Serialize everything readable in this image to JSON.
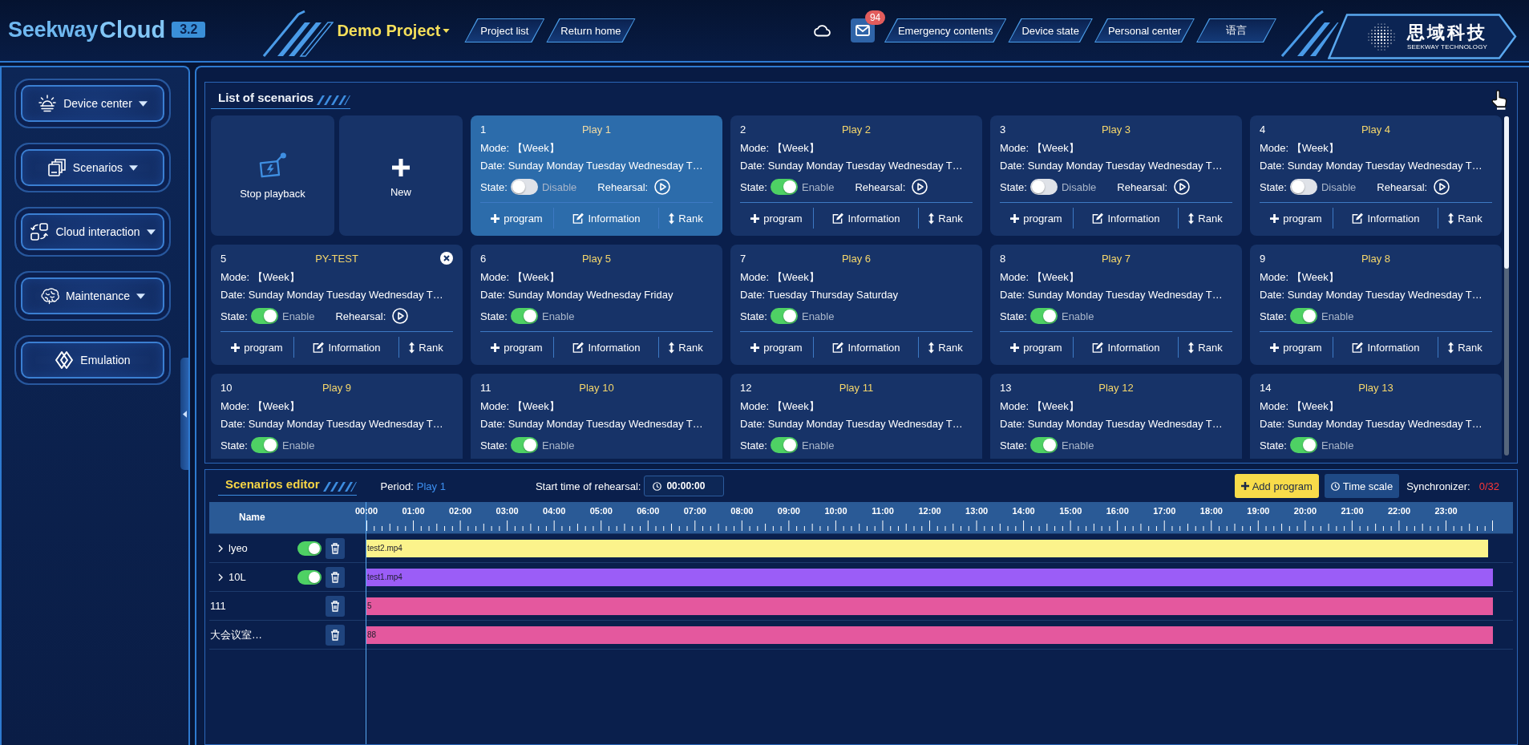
{
  "header": {
    "logo": {
      "brand": "Seekway",
      "product": "Cloud",
      "version": "3.2"
    },
    "project": {
      "label": "Demo Project"
    },
    "nav_left": [
      {
        "label": "Project list"
      },
      {
        "label": "Return home"
      }
    ],
    "notifications": {
      "count": "94"
    },
    "nav_right": [
      {
        "label": "Emergency contents"
      },
      {
        "label": "Device state"
      },
      {
        "label": "Personal center"
      },
      {
        "label": "语言"
      }
    ],
    "company": {
      "name": "思域科技",
      "subtitle": "SEEKWAY TECHNOLOGY"
    }
  },
  "sidebar": {
    "items": [
      {
        "label": "Device center",
        "expandable": true,
        "selected": false
      },
      {
        "label": "Scenarios",
        "expandable": true,
        "selected": false
      },
      {
        "label": "Cloud interaction",
        "expandable": true,
        "selected": false
      },
      {
        "label": "Maintenance",
        "expandable": true,
        "selected": false
      },
      {
        "label": "Emulation",
        "expandable": false,
        "selected": false
      }
    ]
  },
  "scenarios": {
    "title": "List of scenarios",
    "quick_actions": [
      {
        "kind": "stop",
        "label": "Stop playback"
      },
      {
        "kind": "new",
        "label": "New"
      }
    ],
    "cards": [
      {
        "number": "1",
        "title": "Play 1",
        "selected": true,
        "deletable": false,
        "mode": "Mode: 【Week】",
        "date": "Date: Sunday Monday Tuesday Wednesday T…",
        "state_label": "State:",
        "enabled": false,
        "state_text": "Disable",
        "rehearsal": "Rehearsal:",
        "actions": [
          {
            "kind": "program",
            "label": "program"
          },
          {
            "kind": "info",
            "label": "Information"
          },
          {
            "kind": "rank",
            "label": "Rank"
          }
        ]
      },
      {
        "number": "2",
        "title": "Play 2",
        "selected": false,
        "deletable": false,
        "mode": "Mode: 【Week】",
        "date": "Date: Sunday Monday Tuesday Wednesday T…",
        "state_label": "State:",
        "enabled": true,
        "state_text": "Enable",
        "rehearsal": "Rehearsal:",
        "actions": [
          {
            "kind": "program",
            "label": "program"
          },
          {
            "kind": "info",
            "label": "Information"
          },
          {
            "kind": "rank",
            "label": "Rank"
          }
        ]
      },
      {
        "number": "3",
        "title": "Play 3",
        "selected": false,
        "deletable": false,
        "mode": "Mode: 【Week】",
        "date": "Date: Sunday Monday Tuesday Wednesday T…",
        "state_label": "State:",
        "enabled": false,
        "state_text": "Disable",
        "rehearsal": "Rehearsal:",
        "actions": [
          {
            "kind": "program",
            "label": "program"
          },
          {
            "kind": "info",
            "label": "Information"
          },
          {
            "kind": "rank",
            "label": "Rank"
          }
        ]
      },
      {
        "number": "4",
        "title": "Play 4",
        "selected": false,
        "deletable": false,
        "mode": "Mode: 【Week】",
        "date": "Date: Sunday Monday Tuesday Wednesday T…",
        "state_label": "State:",
        "enabled": false,
        "state_text": "Disable",
        "rehearsal": "Rehearsal:",
        "actions": [
          {
            "kind": "program",
            "label": "program"
          },
          {
            "kind": "info",
            "label": "Information"
          },
          {
            "kind": "rank",
            "label": "Rank"
          }
        ]
      },
      {
        "number": "5",
        "title": "PY-TEST",
        "selected": false,
        "deletable": true,
        "mode": "Mode: 【Week】",
        "date": "Date: Sunday Monday Tuesday Wednesday T…",
        "state_label": "State:",
        "enabled": true,
        "state_text": "Enable",
        "rehearsal": "Rehearsal:",
        "actions": [
          {
            "kind": "program",
            "label": "program"
          },
          {
            "kind": "info",
            "label": "Information"
          },
          {
            "kind": "rank",
            "label": "Rank"
          }
        ]
      },
      {
        "number": "6",
        "title": "Play 5",
        "selected": false,
        "deletable": false,
        "mode": "Mode: 【Week】",
        "date": "Date: Sunday Monday Wednesday Friday",
        "state_label": "State:",
        "enabled": true,
        "state_text": "Enable",
        "actions": [
          {
            "kind": "program",
            "label": "program"
          },
          {
            "kind": "info",
            "label": "Information"
          },
          {
            "kind": "rank",
            "label": "Rank"
          }
        ]
      },
      {
        "number": "7",
        "title": "Play 6",
        "selected": false,
        "deletable": false,
        "mode": "Mode: 【Week】",
        "date": "Date: Tuesday Thursday Saturday",
        "state_label": "State:",
        "enabled": true,
        "state_text": "Enable",
        "actions": [
          {
            "kind": "program",
            "label": "program"
          },
          {
            "kind": "info",
            "label": "Information"
          },
          {
            "kind": "rank",
            "label": "Rank"
          }
        ]
      },
      {
        "number": "8",
        "title": "Play 7",
        "selected": false,
        "deletable": false,
        "mode": "Mode: 【Week】",
        "date": "Date: Sunday Monday Tuesday Wednesday T…",
        "state_label": "State:",
        "enabled": true,
        "state_text": "Enable",
        "actions": [
          {
            "kind": "program",
            "label": "program"
          },
          {
            "kind": "info",
            "label": "Information"
          },
          {
            "kind": "rank",
            "label": "Rank"
          }
        ]
      },
      {
        "number": "9",
        "title": "Play 8",
        "selected": false,
        "deletable": false,
        "mode": "Mode: 【Week】",
        "date": "Date: Sunday Monday Tuesday Wednesday T…",
        "state_label": "State:",
        "enabled": true,
        "state_text": "Enable",
        "actions": [
          {
            "kind": "program",
            "label": "program"
          },
          {
            "kind": "info",
            "label": "Information"
          },
          {
            "kind": "rank",
            "label": "Rank"
          }
        ]
      },
      {
        "number": "10",
        "title": "Play 9",
        "selected": false,
        "deletable": false,
        "mode": "Mode: 【Week】",
        "date": "Date: Sunday Monday Tuesday Wednesday T…",
        "state_label": "State:",
        "enabled": true,
        "state_text": "Enable"
      },
      {
        "number": "11",
        "title": "Play 10",
        "selected": false,
        "deletable": false,
        "mode": "Mode: 【Week】",
        "date": "Date: Sunday Monday Tuesday Wednesday T…",
        "state_label": "State:",
        "enabled": true,
        "state_text": "Enable"
      },
      {
        "number": "12",
        "title": "Play 11",
        "selected": false,
        "deletable": false,
        "mode": "Mode: 【Week】",
        "date": "Date: Sunday Monday Tuesday Wednesday T…",
        "state_label": "State:",
        "enabled": true,
        "state_text": "Enable"
      },
      {
        "number": "13",
        "title": "Play 12",
        "selected": false,
        "deletable": false,
        "mode": "Mode: 【Week】",
        "date": "Date: Sunday Monday Tuesday Wednesday T…",
        "state_label": "State:",
        "enabled": true,
        "state_text": "Enable"
      },
      {
        "number": "14",
        "title": "Play 13",
        "selected": false,
        "deletable": false,
        "mode": "Mode: 【Week】",
        "date": "Date: Sunday Monday Tuesday Wednesday T…",
        "state_label": "State:",
        "enabled": true,
        "state_text": "Enable"
      }
    ]
  },
  "editor": {
    "title": "Scenarios editor",
    "period_label": "Period:",
    "period_value": "Play 1",
    "start_label": "Start time of rehearsal:",
    "start_time": {
      "value": "00:00:00"
    },
    "buttons": [
      {
        "kind": "add",
        "label": "Add program"
      },
      {
        "kind": "scale",
        "label": "Time scale"
      }
    ],
    "sync_label": "Synchronizer:",
    "sync_value": "0/32",
    "timeline": {
      "name_header": "Name",
      "hours": [
        "00:00",
        "01:00",
        "02:00",
        "03:00",
        "04:00",
        "05:00",
        "06:00",
        "07:00",
        "08:00",
        "09:00",
        "10:00",
        "11:00",
        "12:00",
        "13:00",
        "14:00",
        "15:00",
        "16:00",
        "17:00",
        "18:00",
        "19:00",
        "20:00",
        "21:00",
        "22:00",
        "23:00"
      ],
      "rows": [
        {
          "kind": "group",
          "name": "lyeo",
          "expanded": false,
          "enabled": true,
          "clip": {
            "label": "test2.mp4",
            "color": "#fbf38b",
            "level": 0.996
          }
        },
        {
          "kind": "group",
          "name": "10L",
          "expanded": false,
          "enabled": true,
          "clip": {
            "label": "test1.mp4",
            "color": "#9b5df7",
            "level": 1
          }
        },
        {
          "kind": "item",
          "name": "111",
          "clip": {
            "label": "5",
            "color": "#e4589e",
            "level": 1
          }
        },
        {
          "kind": "item",
          "name": "大会议室…",
          "clip": {
            "label": "88",
            "color": "#e4589e",
            "level": 1
          }
        }
      ]
    }
  }
}
